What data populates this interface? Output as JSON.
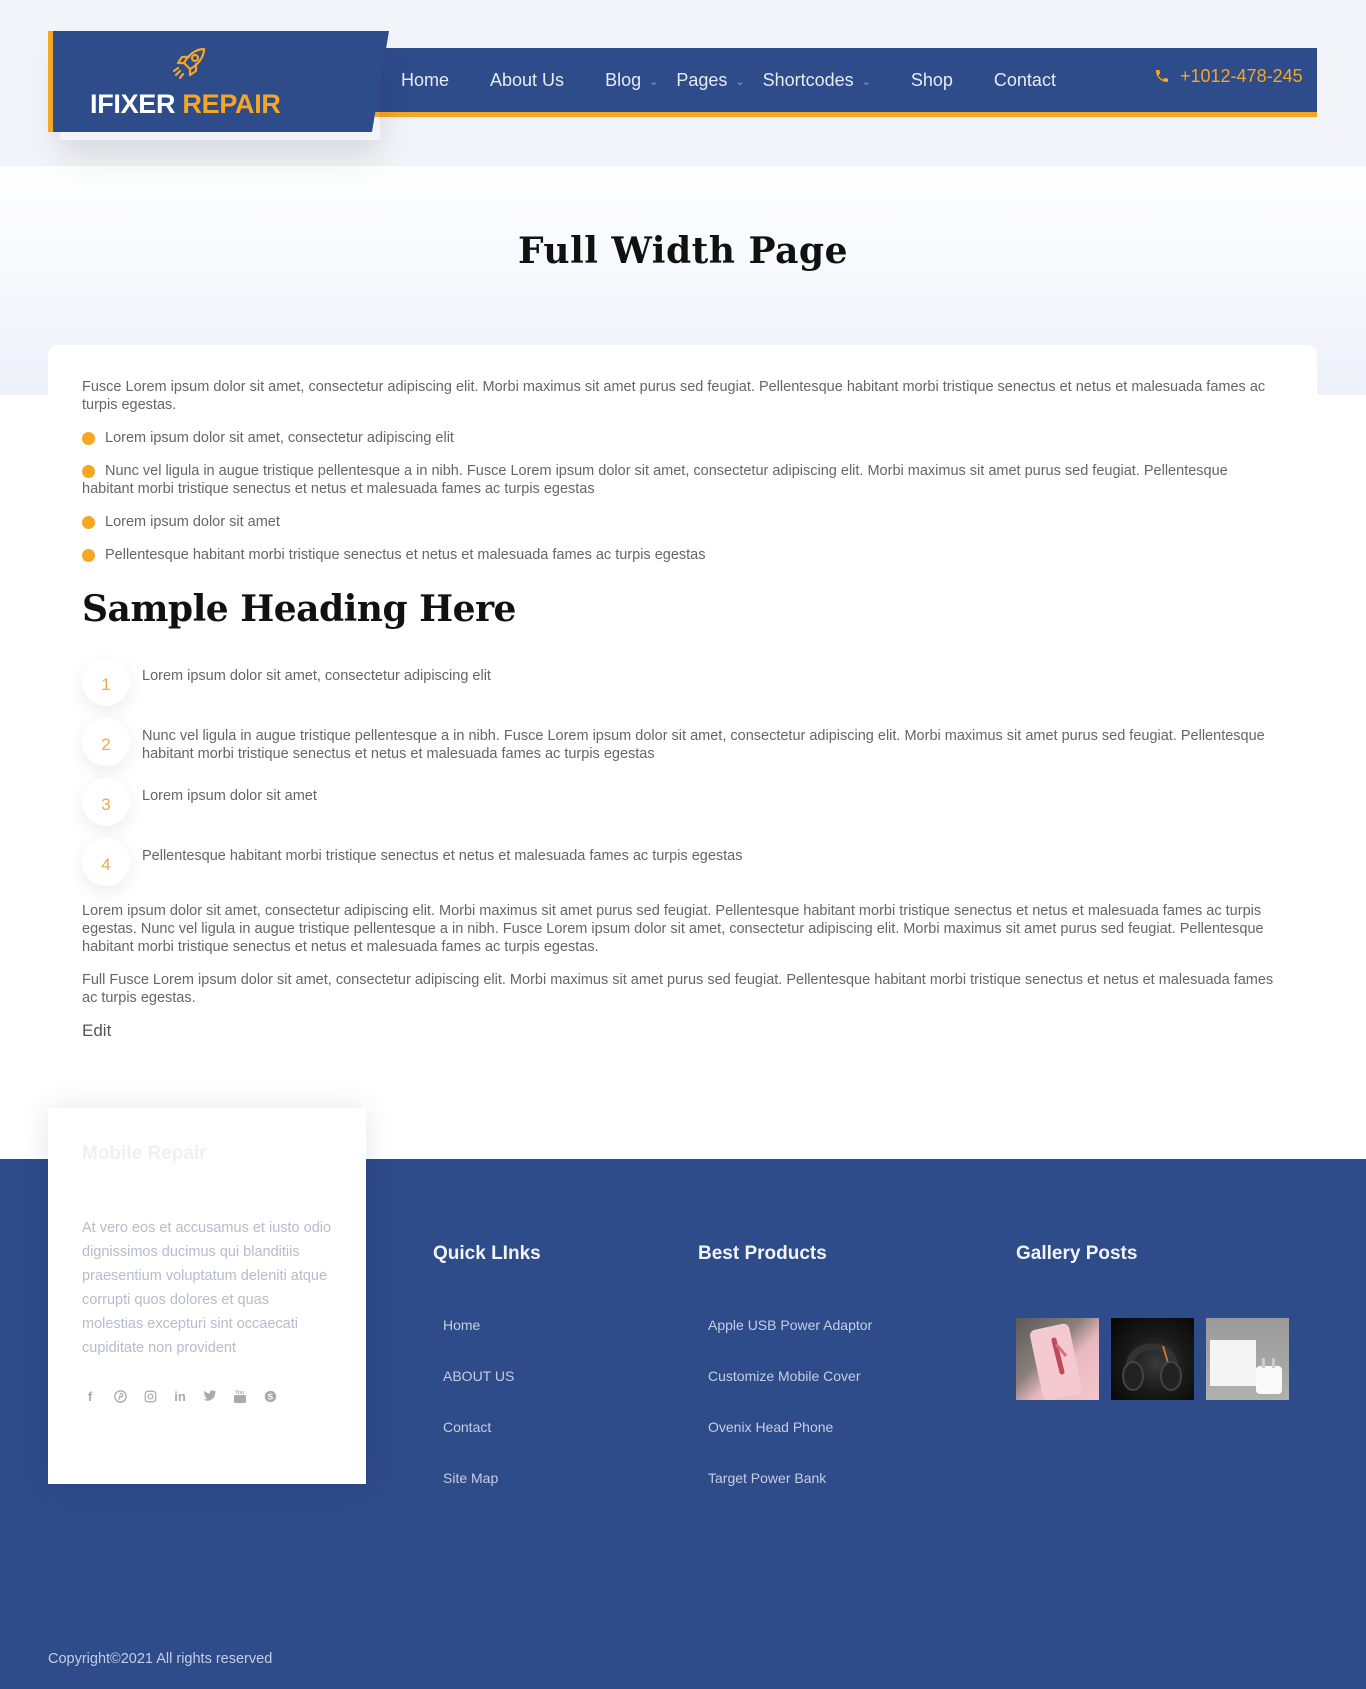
{
  "header": {
    "logo": {
      "icon": "rocket-icon",
      "text_main": "IFIXER",
      "text_accent": "REPAIR"
    },
    "nav": [
      {
        "label": "Home",
        "has_dropdown": false
      },
      {
        "label": "About Us",
        "has_dropdown": false
      },
      {
        "label": "Blog",
        "has_dropdown": true
      },
      {
        "label": "Pages",
        "has_dropdown": true
      },
      {
        "label": "Shortcodes",
        "has_dropdown": true
      },
      {
        "label": "Shop",
        "has_dropdown": false
      },
      {
        "label": "Contact",
        "has_dropdown": false
      }
    ],
    "phone": {
      "icon": "phone-icon",
      "number": "+1012-478-245"
    }
  },
  "hero": {
    "title": "Full Width Page"
  },
  "content": {
    "intro": "Fusce Lorem ipsum dolor sit amet, consectetur adipiscing elit. Morbi maximus sit amet purus sed feugiat. Pellentesque habitant morbi tristique senectus et netus et malesuada fames ac turpis egestas.",
    "bullets": [
      "Lorem ipsum dolor sit amet, consectetur adipiscing elit",
      "Nunc vel ligula in augue tristique pellentesque a in nibh. Fusce Lorem ipsum dolor sit amet, consectetur adipiscing elit. Morbi maximus sit amet purus sed feugiat. Pellentesque habitant morbi tristique senectus et netus et malesuada fames ac turpis egestas",
      "Lorem ipsum dolor sit amet",
      "Pellentesque habitant morbi tristique senectus et netus et malesuada fames ac turpis egestas"
    ],
    "heading": "Sample Heading Here",
    "numbered": [
      {
        "num": "1",
        "text": "Lorem ipsum dolor sit amet, consectetur adipiscing elit"
      },
      {
        "num": "2",
        "text": "Nunc vel ligula in augue tristique pellentesque a in nibh. Fusce Lorem ipsum dolor sit amet, consectetur adipiscing elit. Morbi maximus sit amet purus sed feugiat. Pellentesque habitant morbi tristique senectus et netus et malesuada fames ac turpis egestas"
      },
      {
        "num": "3",
        "text": "Lorem ipsum dolor sit amet"
      },
      {
        "num": "4",
        "text": "Pellentesque habitant morbi tristique senectus et netus et malesuada fames ac turpis egestas"
      }
    ],
    "para1": "Lorem ipsum dolor sit amet, consectetur adipiscing elit. Morbi maximus sit amet purus sed feugiat. Pellentesque habitant morbi tristique senectus et netus et malesuada fames ac turpis egestas. Nunc vel ligula in augue tristique pellentesque a in nibh. Fusce Lorem ipsum dolor sit amet, consectetur adipiscing elit. Morbi maximus sit amet purus sed feugiat. Pellentesque habitant morbi tristique senectus et netus et malesuada fames ac turpis egestas.",
    "para2": "Full Fusce Lorem ipsum dolor sit amet, consectetur adipiscing elit. Morbi maximus sit amet purus sed feugiat. Pellentesque habitant morbi tristique senectus et netus et malesuada fames ac turpis egestas.",
    "edit_label": "Edit"
  },
  "footer": {
    "about": {
      "title": "Mobile Repair",
      "text": "At vero eos et accusamus et iusto odio dignissimos ducimus qui blanditiis praesentium voluptatum deleniti atque corrupti quos dolores et quas molestias excepturi sint occaecati cupiditate non provident",
      "socials": [
        "facebook-icon",
        "pinterest-icon",
        "instagram-icon",
        "linkedin-icon",
        "twitter-icon",
        "youtube-icon",
        "skype-icon"
      ]
    },
    "quick_links": {
      "title": "Quick LInks",
      "items": [
        "Home",
        "ABOUT US",
        "Contact",
        "Site Map"
      ]
    },
    "best_products": {
      "title": "Best Products",
      "items": [
        "Apple USB Power Adaptor",
        "Customize Mobile Cover",
        "Ovenix Head Phone",
        "Target Power Bank"
      ]
    },
    "gallery": {
      "title": "Gallery Posts",
      "images": [
        "pink-phone-case-photo",
        "headphones-photo",
        "usb-power-adapter-photo"
      ]
    },
    "copyright": "Copyright©2021 All rights reserved"
  },
  "colors": {
    "brand_blue": "#2e4b8a",
    "accent_orange": "#f5a623",
    "header_bg": "#f3f4f9"
  }
}
